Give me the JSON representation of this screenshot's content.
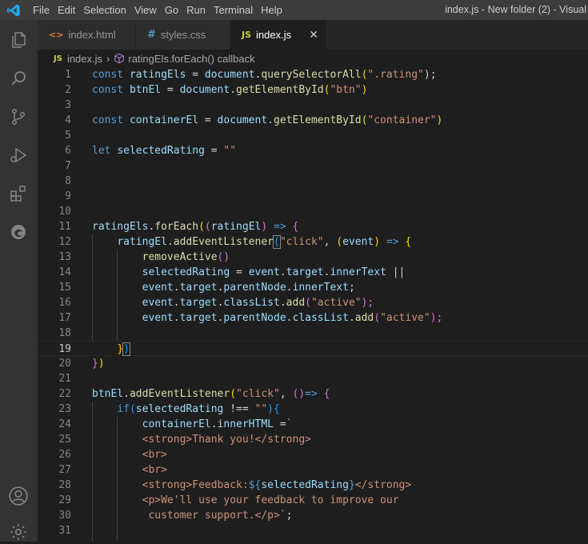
{
  "titlebar": {
    "menu": [
      "File",
      "Edit",
      "Selection",
      "View",
      "Go",
      "Run",
      "Terminal",
      "Help"
    ],
    "window_title": "index.js - New folder (2) - Visual"
  },
  "tabs": [
    {
      "label": "index.html",
      "icon": "html-file-icon",
      "icon_text": "<>",
      "icon_color": "#e37933"
    },
    {
      "label": "styles.css",
      "icon": "css-file-icon",
      "icon_text": "#",
      "icon_color": "#519aba"
    },
    {
      "label": "index.js",
      "icon": "js-file-icon",
      "icon_text": "JS",
      "icon_color": "#cbcb41",
      "active": true
    }
  ],
  "breadcrumb": {
    "file": "index.js",
    "symbol": "ratingEls.forEach() callback"
  },
  "editor": {
    "current_line": 19,
    "lines": [
      {
        "n": "1"
      },
      {
        "n": "2"
      },
      {
        "n": "3"
      },
      {
        "n": "4"
      },
      {
        "n": "5"
      },
      {
        "n": "6"
      },
      {
        "n": "7"
      },
      {
        "n": "8"
      },
      {
        "n": "9"
      },
      {
        "n": "10"
      },
      {
        "n": "11"
      },
      {
        "n": "12"
      },
      {
        "n": "13"
      },
      {
        "n": "14"
      },
      {
        "n": "15"
      },
      {
        "n": "16"
      },
      {
        "n": "17"
      },
      {
        "n": "18"
      },
      {
        "n": "19"
      },
      {
        "n": "20"
      },
      {
        "n": "21"
      },
      {
        "n": "22"
      },
      {
        "n": "23"
      },
      {
        "n": "24"
      },
      {
        "n": "25"
      },
      {
        "n": "26"
      },
      {
        "n": "27"
      },
      {
        "n": "28"
      },
      {
        "n": "29"
      },
      {
        "n": "30"
      },
      {
        "n": "31"
      }
    ],
    "code": {
      "l1": [
        "const",
        " ",
        "ratingEls",
        " = ",
        "document",
        ".",
        "querySelectorAll",
        "(",
        "\".rating\"",
        ");"
      ],
      "l2": [
        "const",
        " ",
        "btnEl",
        " = ",
        "document",
        ".",
        "getElementById",
        "(",
        "\"btn\"",
        ")"
      ],
      "l4": [
        "const",
        " ",
        "containerEl",
        " = ",
        "document",
        ".",
        "getElementById",
        "(",
        "\"container\"",
        ")"
      ],
      "l6": [
        "let",
        " ",
        "selectedRating",
        " = ",
        "\"\""
      ],
      "l11": [
        "ratingEls",
        ".",
        "forEach",
        "(",
        "(",
        "ratingEl",
        ")",
        " => ",
        "{"
      ],
      "l12": [
        "    ",
        "ratingEl",
        ".",
        "addEventListener",
        "(",
        "\"click\"",
        ", ",
        "(",
        "event",
        ")",
        " => ",
        "{"
      ],
      "l13": [
        "        ",
        "removeActive",
        "()"
      ],
      "l14": [
        "        ",
        "selectedRating",
        " = ",
        "event",
        ".",
        "target",
        ".",
        "innerText",
        " ||"
      ],
      "l15": [
        "        ",
        "event",
        ".",
        "target",
        ".",
        "parentNode",
        ".",
        "innerText",
        ";"
      ],
      "l16": [
        "        ",
        "event",
        ".",
        "target",
        ".",
        "classList",
        ".",
        "add",
        "(",
        "\"active\"",
        ");"
      ],
      "l17": [
        "        ",
        "event",
        ".",
        "target",
        ".",
        "parentNode",
        ".",
        "classList",
        ".",
        "add",
        "(",
        "\"active\"",
        ");"
      ],
      "l19": [
        "    ",
        "}",
        ")"
      ],
      "l20": [
        "}",
        ")"
      ],
      "l22": [
        "btnEl",
        ".",
        "addEventListener",
        "(",
        "\"click\"",
        ", ",
        "()",
        "=>",
        " ",
        "{"
      ],
      "l23": [
        "    ",
        "if",
        "(",
        "selectedRating",
        " !== ",
        "\"\"",
        ")",
        "{"
      ],
      "l24": [
        "        ",
        "containerEl",
        ".",
        "innerHTML",
        " =",
        "`"
      ],
      "l25": [
        "        ",
        "<",
        "strong",
        ">",
        "Thank you!",
        "</",
        "strong",
        ">"
      ],
      "l26": [
        "        ",
        "<",
        "br",
        ">"
      ],
      "l27": [
        "        ",
        "<",
        "br",
        ">"
      ],
      "l28": [
        "        ",
        "<",
        "strong",
        ">",
        "Feedback:",
        "${",
        "selectedRating",
        "}",
        "</",
        "strong",
        ">"
      ],
      "l29": [
        "        ",
        "<",
        "p",
        ">",
        "We'll use your feedback to improve our"
      ],
      "l30": [
        "         ",
        "customer support.",
        "</",
        "p",
        ">",
        "`",
        ";"
      ]
    }
  },
  "activity_icons": [
    "explorer-icon",
    "search-icon",
    "source-control-icon",
    "run-debug-icon",
    "extensions-icon",
    "edge-devtools-icon",
    "account-icon",
    "settings-gear-icon"
  ]
}
